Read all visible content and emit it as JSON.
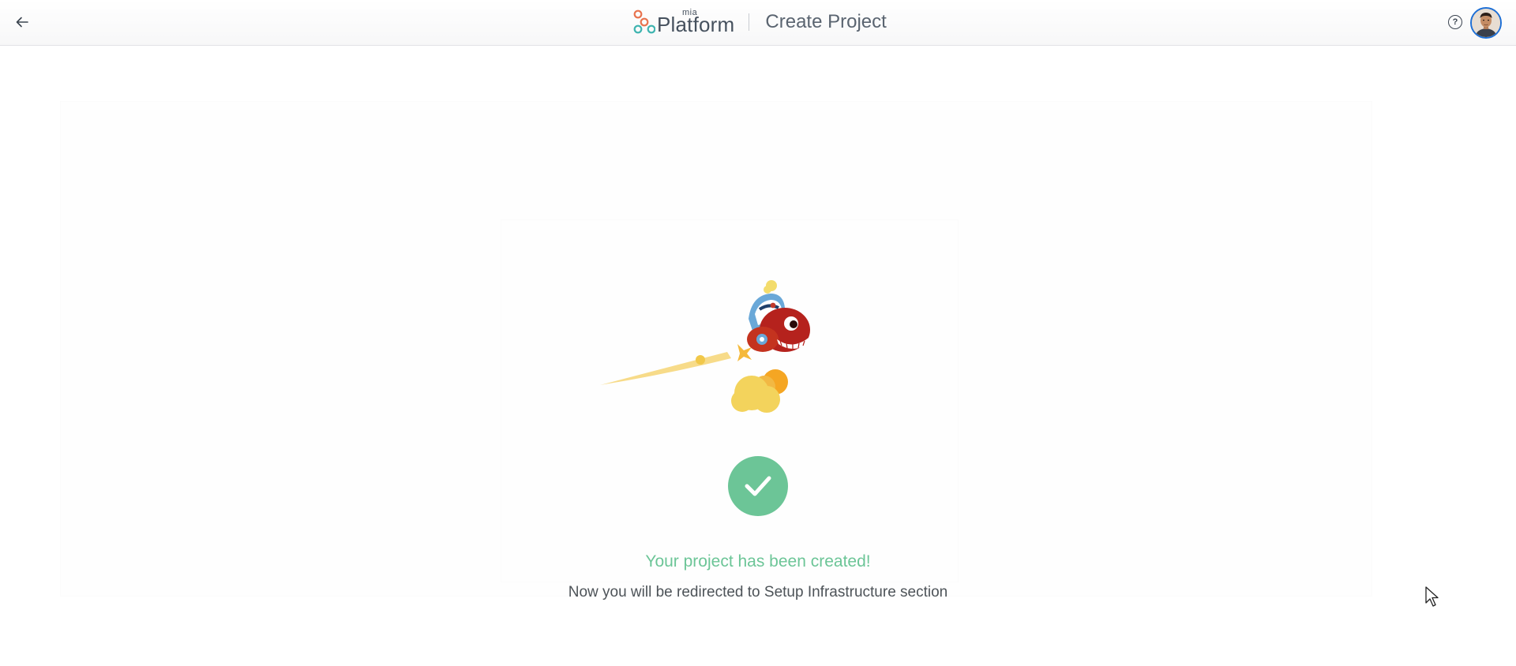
{
  "header": {
    "back_icon": "arrow-left-icon",
    "brand_small": "mia",
    "brand_name": "Platform",
    "page_title": "Create Project",
    "help_icon": "question-circle-icon",
    "help_glyph": "?",
    "avatar_icon": "user-avatar"
  },
  "main": {
    "illustration": "rocket-mascot-illustration",
    "success_icon": "check-icon",
    "success_title": "Your project has been created!",
    "success_subtitle": "Now you will be redirected to Setup Infrastructure section"
  },
  "colors": {
    "accent_green": "#6cc597",
    "text_dark": "#46515e",
    "avatar_ring": "#1d6fd6"
  }
}
